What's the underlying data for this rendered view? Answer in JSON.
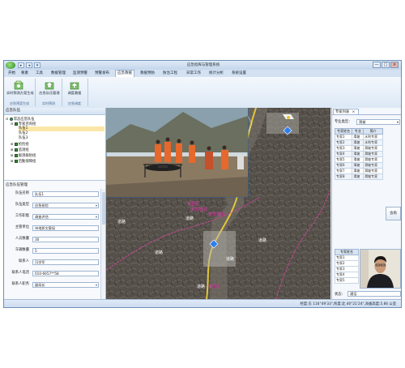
{
  "window": {
    "title": "应急指挥与管理系统",
    "controls": [
      "—",
      "□",
      "×"
    ],
    "quick_access": [
      "▸",
      "◂",
      "▾"
    ]
  },
  "menu": {
    "items": [
      "开始",
      "要素",
      "工具",
      "数据管理",
      "监测预警",
      "预警发布",
      "应急救援",
      "救援预防",
      "防治工程",
      "日常工作",
      "统计分析",
      "系统设置"
    ],
    "active_index": 6
  },
  "ribbon": {
    "buttons": [
      "实时预测方案生成",
      "应急队伍管理",
      "调度救援"
    ],
    "groups": [
      "应急预案生成",
      "实时预测",
      "应急调度"
    ]
  },
  "left_panel": {
    "header": "应急队伍",
    "tree": [
      {
        "label": "常态应急队伍",
        "level": 0
      },
      {
        "label": "专家咨询组",
        "level": 1
      },
      {
        "label": "队伍1",
        "level": 2,
        "selected": true
      },
      {
        "label": "队伍2",
        "level": 2
      },
      {
        "label": "队伍3",
        "level": 2
      },
      {
        "label": "抢险组",
        "level": 1
      },
      {
        "label": "监测组",
        "level": 1
      },
      {
        "label": "群测群防组",
        "level": 1
      },
      {
        "label": "后勤保障组",
        "level": 1
      }
    ],
    "form_header": "应急队伍管理",
    "form": [
      {
        "label": "队伍名称",
        "value": "队伍1",
        "select": false
      },
      {
        "label": "队伍类型",
        "value": "应急抢险",
        "select": true
      },
      {
        "label": "工作职能",
        "value": "调查评估",
        "select": true
      },
      {
        "label": "主管单位",
        "value": "市地质灾害局",
        "select": false
      },
      {
        "label": "人员数量",
        "value": "30",
        "select": false
      },
      {
        "label": "车辆数量",
        "value": "5",
        "select": false
      },
      {
        "label": "联系人",
        "value": "冯学军",
        "select": false
      },
      {
        "label": "联系人电话",
        "value": "010-6657**58",
        "select": false
      },
      {
        "label": "联系人职务",
        "value": "副局长",
        "select": true
      }
    ]
  },
  "map": {
    "labels": [
      "安置区",
      "灾害范围",
      "灾害范围",
      "安置区",
      "道路",
      "道路",
      "道路",
      "道路",
      "道路",
      "道路"
    ]
  },
  "right_panel": {
    "tab": "专家列表",
    "tab_close": "×",
    "type_label": "专业类型：",
    "type_value": "滑坡",
    "expert_table": {
      "headers": [
        "专家姓名",
        "专业",
        "简介"
      ],
      "rows": [
        [
          "专家1",
          "滑坡",
          "水利专家"
        ],
        [
          "专家2",
          "滑坡",
          "水利专家"
        ],
        [
          "专家3",
          "滑坡",
          "滑坡专家"
        ],
        [
          "专家4",
          "滑坡",
          "滑坡专家"
        ],
        [
          "专家5",
          "滑坡",
          "滑坡专家"
        ],
        [
          "专家6",
          "滑坡",
          "滑坡专家"
        ],
        [
          "专家7",
          "滑坡",
          "滑坡专家"
        ],
        [
          "专家8",
          "滑坡",
          "滑坡专家"
        ]
      ]
    },
    "consult_button": "会商",
    "consult_table": {
      "header": "专家姓名",
      "rows": [
        "专家1",
        "专家2",
        "专家3",
        "专家4",
        "专家5"
      ]
    },
    "status_label": "状态：",
    "status_value": "通话"
  },
  "statusbar": {
    "text": "经度:东 116°49'33\",纬度:北 40°21'24\",海拔高度:5.66 公里"
  }
}
